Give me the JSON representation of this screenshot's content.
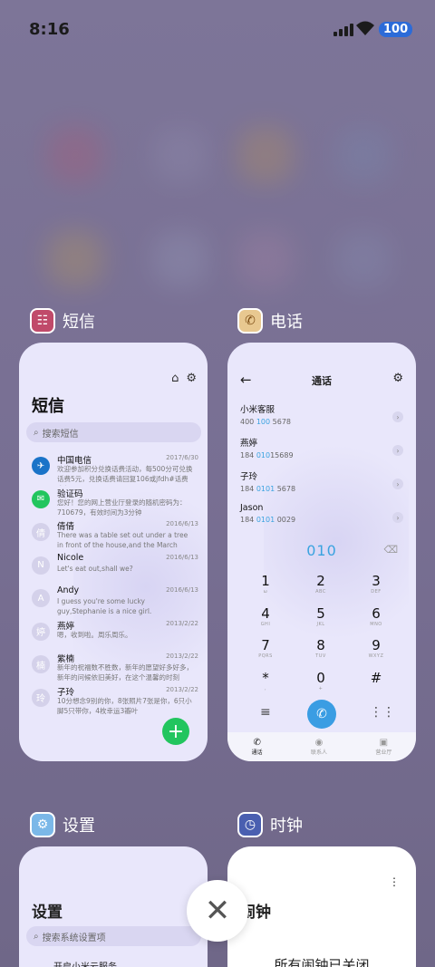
{
  "status_bar": {
    "time": "8:16",
    "battery": "100"
  },
  "cards": {
    "sms": {
      "app_name": "短信",
      "title": "短信",
      "search_placeholder": "搜索短信",
      "messages": [
        {
          "name": "中国电信",
          "date": "2017/6/30",
          "preview": "欢迎参加积分兑换话费活动，每500分可兑换话费5元，兑换话费请回复106或jfdh#话费金额",
          "avatar": "✈"
        },
        {
          "name": "验证码",
          "date": "",
          "preview": "您好！您的网上营业厅登录的随机密码为：710679，有效时间为3分钟",
          "avatar": "✉"
        },
        {
          "name": "倩倩",
          "date": "2016/6/13",
          "preview": "There was a table set out under a tree in front of the house,and the March Hare and",
          "avatar": "倩"
        },
        {
          "name": "Nicole",
          "date": "2016/6/13",
          "preview": "Let's eat out,shall we?",
          "avatar": "N"
        },
        {
          "name": "Andy",
          "date": "2016/6/13",
          "preview": "I guess you're some lucky guy,Stephanie is a nice girl.",
          "avatar": "A"
        },
        {
          "name": "燕婷",
          "date": "2013/2/22",
          "preview": "嗯，收到啦。周乐周乐。",
          "avatar": "婷"
        },
        {
          "name": "紫楠",
          "date": "2013/2/22",
          "preview": "新年的祝福数不胜数，新年的愿望好多好多，新年的问候依旧美好，在这个温馨的时刻",
          "avatar": "楠"
        },
        {
          "name": "子玲",
          "date": "2013/2/22",
          "preview": "10分想念9别的你，8张照片7张是你，6只小脚5只带你，4枚幸运3瓣叶",
          "avatar": "玲"
        }
      ]
    },
    "phone": {
      "app_name": "电话",
      "title": "通话",
      "contacts": [
        {
          "name": "小米客服",
          "num_pre": "400 ",
          "num_hl": "100",
          "num_post": " 5678"
        },
        {
          "name": "燕婷",
          "num_pre": "184 ",
          "num_hl": "010",
          "num_post": "15689"
        },
        {
          "name": "子玲",
          "num_pre": "184 ",
          "num_hl": "0101",
          "num_post": " 5678"
        },
        {
          "name": "Jason",
          "num_pre": "184 ",
          "num_hl": "0101",
          "num_post": " 0029"
        }
      ],
      "dial_input": "010",
      "keys": [
        {
          "d": "1",
          "l": "ω"
        },
        {
          "d": "2",
          "l": "ABC"
        },
        {
          "d": "3",
          "l": "DEF"
        },
        {
          "d": "4",
          "l": "GHI"
        },
        {
          "d": "5",
          "l": "JKL"
        },
        {
          "d": "6",
          "l": "MNO"
        },
        {
          "d": "7",
          "l": "PQRS"
        },
        {
          "d": "8",
          "l": "TUV"
        },
        {
          "d": "9",
          "l": "WXYZ"
        },
        {
          "d": "*",
          "l": ","
        },
        {
          "d": "0",
          "l": "+"
        },
        {
          "d": "#",
          "l": ""
        }
      ],
      "tabs": [
        "通话",
        "联系人",
        "营业厅"
      ]
    },
    "settings": {
      "app_name": "设置",
      "title": "设置",
      "search_placeholder": "搜索系统设置项",
      "first_item": "开启小米云服务"
    },
    "clock": {
      "app_name": "时钟",
      "title": "闹钟",
      "status": "所有闹钟已关闭"
    }
  },
  "colors": {
    "accent": "#3a9de3",
    "fab": "#22c55e",
    "card_bg": "#e9e7fb"
  }
}
